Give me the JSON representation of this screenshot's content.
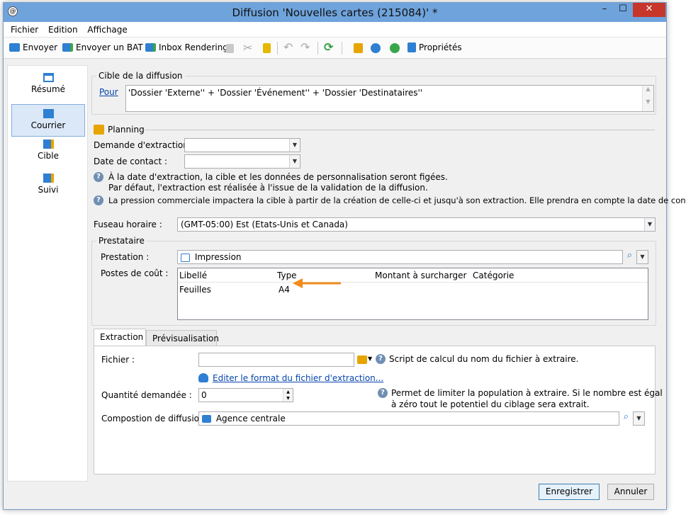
{
  "window": {
    "title": "Diffusion 'Nouvelles cartes (215084)' *",
    "minimize": "–",
    "maximize": "☐",
    "close": "✕"
  },
  "menu": [
    "Fichier",
    "Edition",
    "Affichage"
  ],
  "toolbar": {
    "envoyer": "Envoyer",
    "envoyer_bat": "Envoyer un BAT",
    "inbox": "Inbox Rendering",
    "proprietes": "Propriétés"
  },
  "sidebar": {
    "items": [
      "Résumé",
      "Courrier",
      "Cible",
      "Suivi"
    ]
  },
  "cible": {
    "group_label": "Cible de la diffusion",
    "pour_link": "Pour",
    "text": "'Dossier 'Externe'' + 'Dossier 'Événement'' + 'Dossier 'Destinataires''"
  },
  "planning": {
    "label": "Planning",
    "extraction_label": "Demande d'extraction :",
    "contact_label": "Date de contact :",
    "info1_a": "À la date d'extraction, la cible et les données de personnalisation seront figées.",
    "info1_b": "Par défaut, l'extraction est réalisée à l'issue de la validation de la diffusion.",
    "info2": "La pression commerciale impactera la cible à partir de la création de celle-ci et jusqu'à son extraction. Elle prendra en compte la date de contact."
  },
  "fuseau": {
    "label": "Fuseau horaire :",
    "value": "(GMT-05:00) Est (Etats-Unis et Canada)"
  },
  "prestataire": {
    "group_label": "Prestataire",
    "prestation_label": "Prestation :",
    "prestation_value": "Impression",
    "postes_label": "Postes de coût :",
    "columns": [
      "Libellé",
      "Type",
      "Montant à surcharger",
      "Catégorie"
    ],
    "rows": [
      {
        "libelle": "Feuilles",
        "type": "A4"
      }
    ]
  },
  "tabs": [
    "Extraction",
    "Prévisualisation"
  ],
  "extraction": {
    "fichier_label": "Fichier :",
    "fichier_value": "",
    "fichier_help": "Script de calcul du nom du fichier à extraire.",
    "edit_link": "Editer le format du fichier d'extraction...",
    "quantite_label": "Quantité demandée :",
    "quantite_value": "0",
    "quantite_help_a": "Permet de limiter la population à extraire. Si le nombre est égal",
    "quantite_help_b": "à zéro tout le potentiel du ciblage sera extrait.",
    "composition_label": "Compostion de diffusion:",
    "composition_value": "Agence centrale"
  },
  "buttons": {
    "save": "Enregistrer",
    "cancel": "Annuler"
  },
  "colors": {
    "titlebar": "#6fa3dc",
    "close": "#c7362b",
    "arrow": "#f28c1c"
  }
}
